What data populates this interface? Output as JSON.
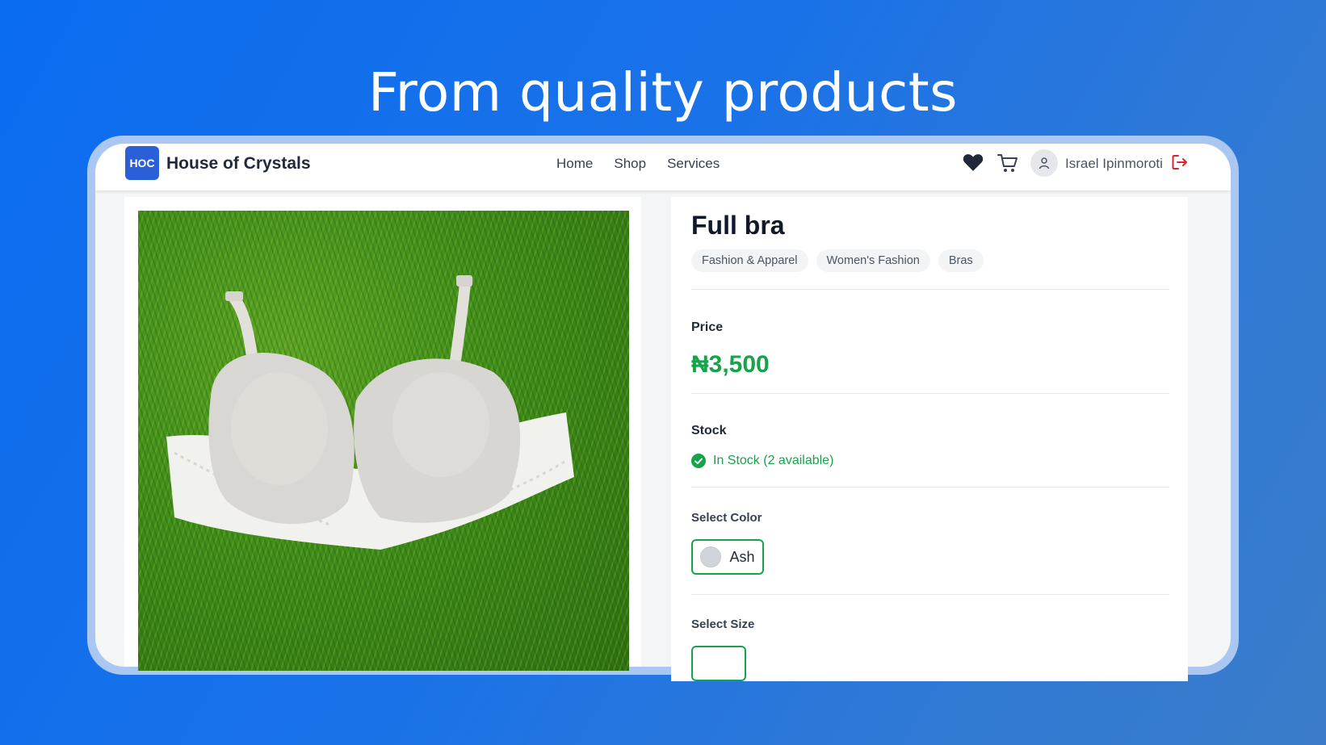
{
  "headline": "From quality products",
  "nav": {
    "logo_badge": "HOC",
    "brand": "House of Crystals",
    "links": [
      "Home",
      "Shop",
      "Services"
    ],
    "username": "Israel Ipinmoroti",
    "icons": [
      "heart-icon",
      "cart-icon",
      "user-icon",
      "logout-icon"
    ]
  },
  "product": {
    "title": "Full bra",
    "tags": [
      "Fashion & Apparel",
      "Women's Fashion",
      "Bras"
    ],
    "price_label": "Price",
    "price": "₦3,500",
    "stock_label": "Stock",
    "stock_status": "In Stock (2 available)",
    "color_label": "Select Color",
    "selected_color": "Ash",
    "size_label": "Select Size"
  },
  "colors": {
    "accent_green": "#16a34a",
    "brand_blue": "#2a5fd8",
    "logout_red": "#dc2626"
  }
}
